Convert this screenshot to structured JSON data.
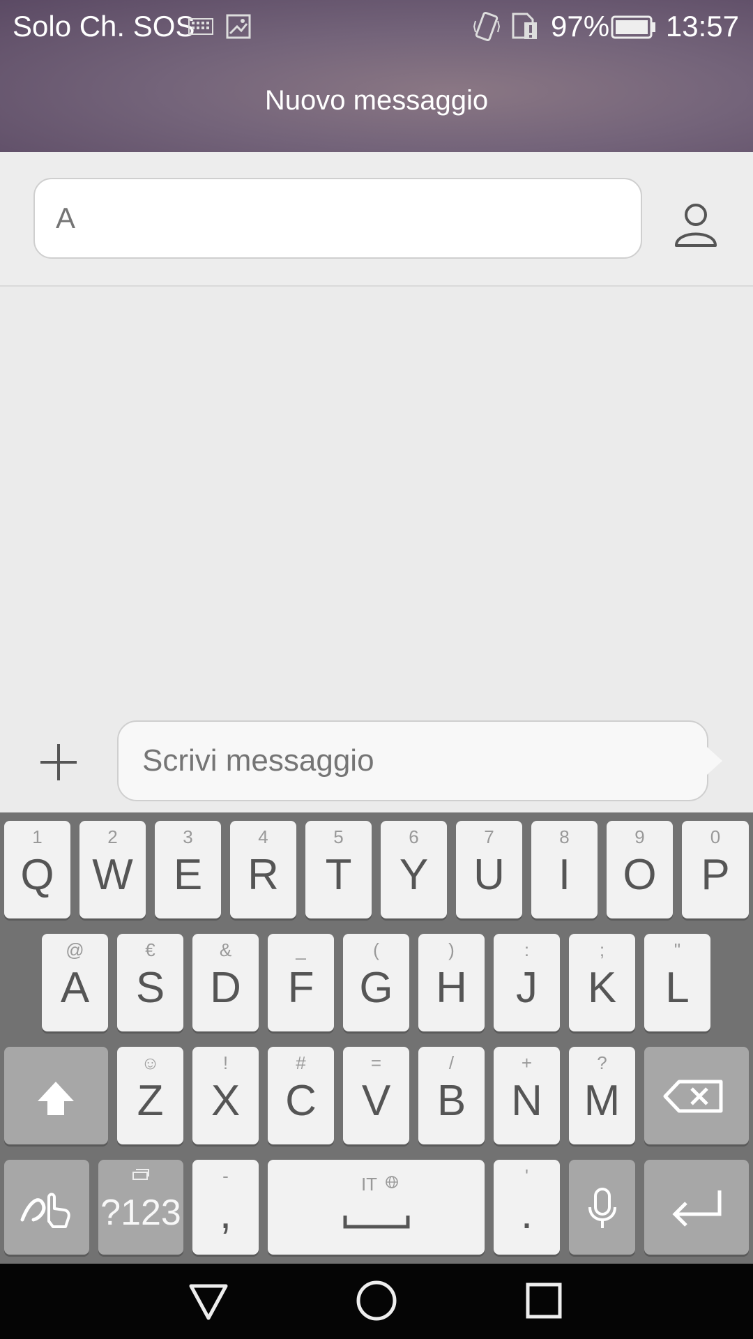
{
  "status_bar": {
    "carrier": "Solo Ch. SOS",
    "battery_percent": "97%",
    "time": "13:57",
    "icons": [
      "keyboard-icon",
      "image-icon",
      "vibrate-icon",
      "sim-alert-icon",
      "battery-icon"
    ]
  },
  "header": {
    "title": "Nuovo messaggio"
  },
  "recipient": {
    "placeholder": "A",
    "value": "",
    "contact_icon": "person-icon"
  },
  "compose": {
    "placeholder": "Scrivi messaggio",
    "value": "",
    "attach_icon": "plus-icon"
  },
  "keyboard": {
    "row1": [
      {
        "sub": "1",
        "main": "Q"
      },
      {
        "sub": "2",
        "main": "W"
      },
      {
        "sub": "3",
        "main": "E"
      },
      {
        "sub": "4",
        "main": "R"
      },
      {
        "sub": "5",
        "main": "T"
      },
      {
        "sub": "6",
        "main": "Y"
      },
      {
        "sub": "7",
        "main": "U"
      },
      {
        "sub": "8",
        "main": "I"
      },
      {
        "sub": "9",
        "main": "O"
      },
      {
        "sub": "0",
        "main": "P"
      }
    ],
    "row2": [
      {
        "sub": "@",
        "main": "A"
      },
      {
        "sub": "€",
        "main": "S"
      },
      {
        "sub": "&",
        "main": "D"
      },
      {
        "sub": "_",
        "main": "F"
      },
      {
        "sub": "(",
        "main": "G"
      },
      {
        "sub": ")",
        "main": "H"
      },
      {
        "sub": ":",
        "main": "J"
      },
      {
        "sub": ";",
        "main": "K"
      },
      {
        "sub": "\"",
        "main": "L"
      }
    ],
    "row3": [
      {
        "sub": "☺",
        "main": "Z"
      },
      {
        "sub": "!",
        "main": "X"
      },
      {
        "sub": "#",
        "main": "C"
      },
      {
        "sub": "=",
        "main": "V"
      },
      {
        "sub": "/",
        "main": "B"
      },
      {
        "sub": "+",
        "main": "N"
      },
      {
        "sub": "?",
        "main": "M"
      }
    ],
    "symbols_label": "?123",
    "comma": {
      "sub": "-",
      "main": ","
    },
    "space_label": "IT",
    "period": {
      "sub": "'",
      "main": "."
    }
  },
  "colors": {
    "header": "#74647a",
    "keyboard_bg": "#727272",
    "key": "#f2f2f2",
    "key_dark": "#a7a7a7"
  }
}
